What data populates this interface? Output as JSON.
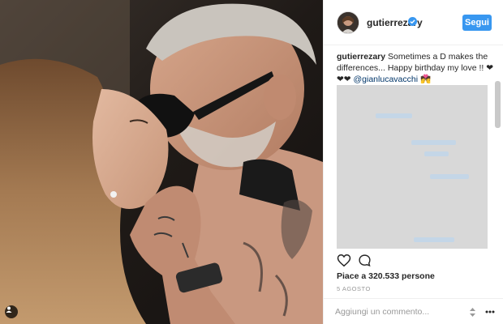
{
  "post": {
    "username": "gutierrezary",
    "follow_label": "Segui",
    "caption_user": "gutierrezary",
    "caption_text": " Sometimes a D makes the differences... Happy birthday my love !! ❤ ❤❤ ",
    "caption_mention": "@gianlucavacchi",
    "caption_end": " 💏",
    "likes_text": "Piace a 320.533 persone",
    "date_text": "5 AGOSTO",
    "comment_placeholder": "Aggiungi un commento..."
  },
  "colors": {
    "accent": "#3897f0",
    "text": "#262626",
    "muted": "#999999"
  },
  "icons": {
    "like": "heart-icon",
    "comment": "comment-icon",
    "options": "more-options-icon",
    "sort": "sort-icon",
    "verified": "verified-icon",
    "tag": "user-tag-icon"
  }
}
